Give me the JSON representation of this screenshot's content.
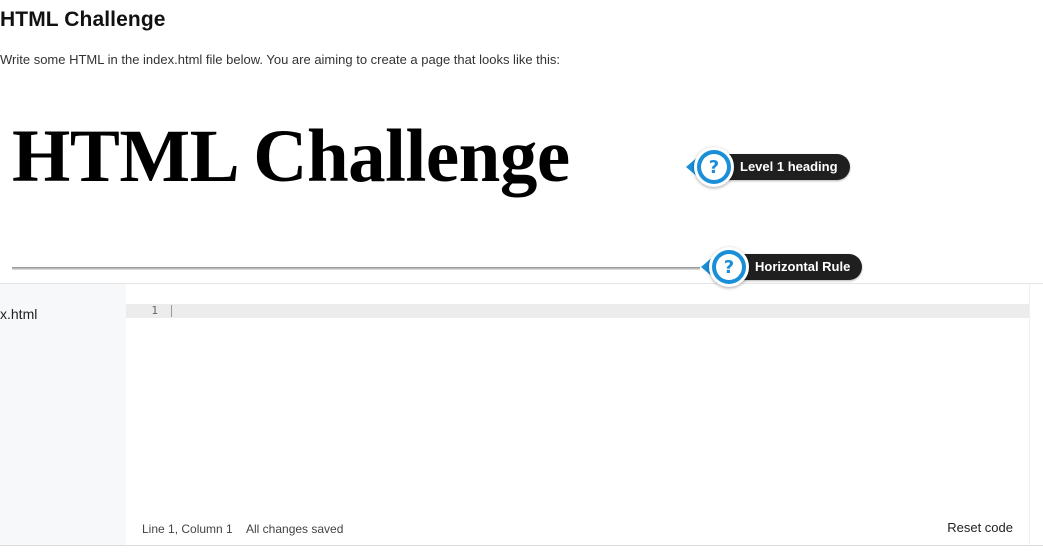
{
  "header": {
    "title": "HTML Challenge",
    "instructions": "Write some HTML in the index.html file below. You are aiming to create a page that looks like this:"
  },
  "preview": {
    "heading_text": "HTML Challenge",
    "callouts": {
      "heading_label": "Level 1 heading",
      "rule_label": "Horizontal Rule",
      "icon": "question-mark"
    }
  },
  "editor": {
    "file_name": "x.html",
    "lines": [
      "1"
    ],
    "status": {
      "position": "Line 1, Column 1",
      "saved": "All changes saved"
    },
    "reset_label": "Reset code"
  },
  "colors": {
    "accent": "#1a8fd8",
    "label_bg": "#1f1f1f",
    "sidebar_bg": "#f7f8fa",
    "active_line": "#ececec"
  }
}
